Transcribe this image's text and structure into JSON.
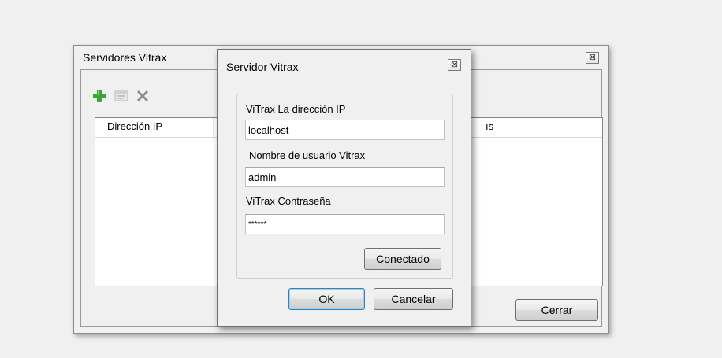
{
  "outer_window": {
    "title": "Servidores Vitrax",
    "close_glyph": "⊠",
    "toolbar": {
      "add_icon": "plus-icon",
      "edit_icon": "edit-icon",
      "delete_icon": "delete-icon"
    },
    "list": {
      "columns": [
        "Dirección IP",
        "ıs"
      ]
    },
    "close_button_label": "Cerrar"
  },
  "dialog": {
    "title": "Servidor Vitrax",
    "close_glyph": "⊠",
    "ip_label": "ViTrax La dirección IP",
    "ip_value": "localhost",
    "user_label": "Nombre de usuario Vitrax",
    "user_value": "admin",
    "password_label": "ViTrax Contraseña",
    "password_value": "******",
    "connect_label": "Conectado",
    "ok_label": "OK",
    "cancel_label": "Cancelar"
  },
  "colors": {
    "add_green": "#3aa53a",
    "delete_gray": "#8e8e8e",
    "ok_border": "#3c7fb1"
  }
}
